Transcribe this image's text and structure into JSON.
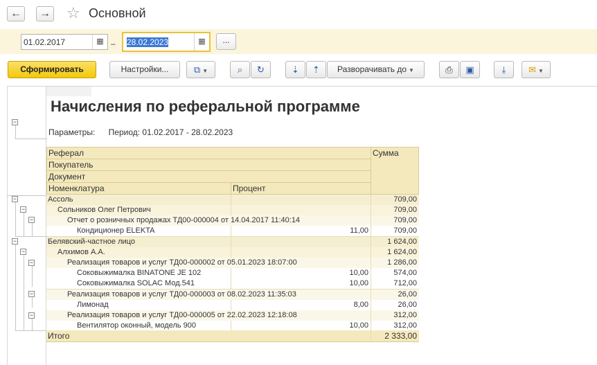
{
  "window": {
    "title": "Основной",
    "back_glyph": "←",
    "forward_glyph": "→",
    "star_glyph": "☆"
  },
  "period": {
    "date_from": "01.02.2017",
    "separator": "–",
    "date_to": "28.02.2023",
    "choose_label": "..."
  },
  "toolbar": {
    "generate_label": "Сформировать",
    "settings_label": "Настройки...",
    "expand_label": "Разворачивать до"
  },
  "report": {
    "title": "Начисления по реферальной программе",
    "params_label": "Параметры:",
    "params_value": "Период: 01.02.2017 - 28.02.2023",
    "headers": {
      "referral": "Реферал",
      "buyer": "Покупатель",
      "document": "Документ",
      "item": "Номенклатура",
      "percent": "Процент",
      "sum": "Сумма"
    },
    "rows": [
      {
        "name": "Ассоль",
        "percent": "",
        "sum": "709,00"
      },
      {
        "name": "Сольников Олег Петрович",
        "percent": "",
        "sum": "709,00"
      },
      {
        "name": "Отчет о розничных продажах ТД00-000004 от 14.04.2017 11:40:14",
        "percent": "",
        "sum": "709,00"
      },
      {
        "name": "Кондиционер ELEKTA",
        "percent": "11,00",
        "sum": "709,00"
      },
      {
        "name": "Белявский-частное лицо",
        "percent": "",
        "sum": "1 624,00"
      },
      {
        "name": "Алхимов А.А.",
        "percent": "",
        "sum": "1 624,00"
      },
      {
        "name": "Реализация товаров и услуг ТД00-000002 от 05.01.2023 18:07:00",
        "percent": "",
        "sum": "1 286,00"
      },
      {
        "name": "Соковыжималка  BINATONE JE 102",
        "percent": "10,00",
        "sum": "574,00"
      },
      {
        "name": "Соковыжималка  SOLAC  Мод.541",
        "percent": "10,00",
        "sum": "712,00"
      },
      {
        "name": "Реализация товаров и услуг ТД00-000003 от 08.02.2023 11:35:03",
        "percent": "",
        "sum": "26,00"
      },
      {
        "name": "Лимонад",
        "percent": "8,00",
        "sum": "26,00"
      },
      {
        "name": "Реализация товаров и услуг ТД00-000005 от 22.02.2023 12:18:08",
        "percent": "",
        "sum": "312,00"
      },
      {
        "name": "Вентилятор оконный, модель 900",
        "percent": "10,00",
        "sum": "312,00"
      }
    ],
    "total": {
      "label": "Итого",
      "sum": "2 333,00"
    },
    "toggle_glyph": "−"
  },
  "icons": {
    "calendar": "calendar-icon",
    "copy": "copy-settings-icon",
    "search": "search-icon",
    "search_next": "find-next-icon",
    "sort_asc": "group-expand-icon",
    "sort_desc": "group-collapse-icon",
    "print": "print-icon",
    "preview": "print-preview-icon",
    "save": "save-icon",
    "mail": "mail-icon"
  },
  "colors": {
    "primary_button": "#f2c80c",
    "report_header": "#f4e9bd",
    "selection": "#3a78d4"
  }
}
